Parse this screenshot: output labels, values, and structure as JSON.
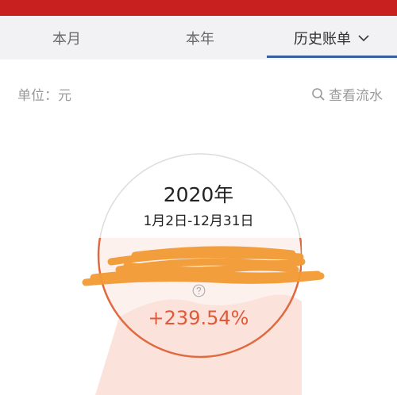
{
  "tabs": [
    {
      "label": "本月"
    },
    {
      "label": "本年"
    },
    {
      "label": "历史账单"
    }
  ],
  "unit_label": "单位：元",
  "search_label": "查看流水",
  "summary": {
    "year": "2020年",
    "date_range": "1月2日-12月31日",
    "percent": "+239.54%"
  },
  "colors": {
    "topbar": "#c8201e",
    "tab_active_underline": "#3b5f9c",
    "ring": "#e0693f",
    "percent": "#e05a3a",
    "redaction": "#f39a33"
  },
  "icons": {
    "dropdown": "chevron-down-icon",
    "search": "search-icon",
    "help": "question-circle-icon"
  }
}
